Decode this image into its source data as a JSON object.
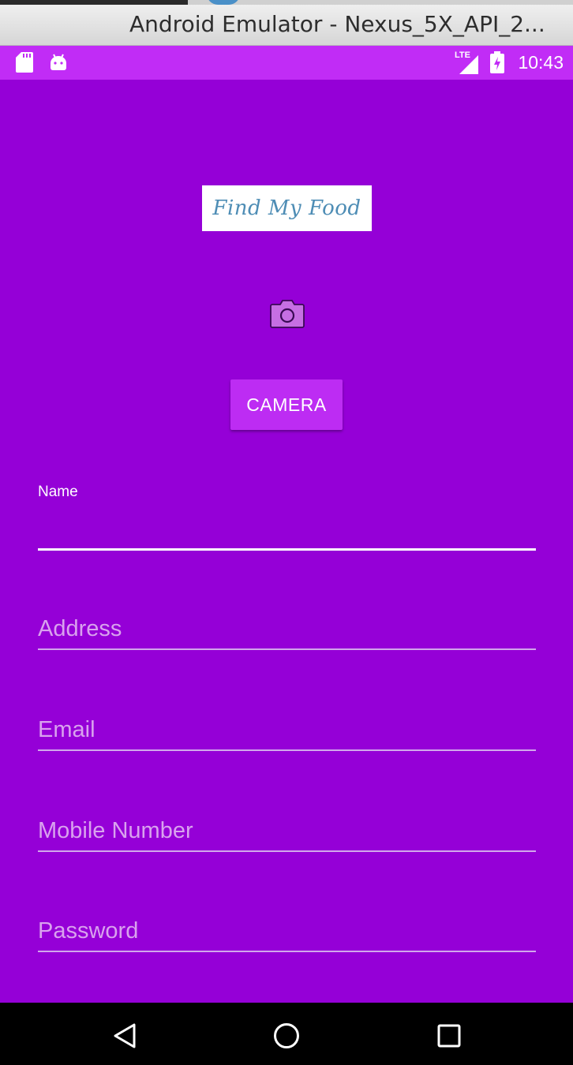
{
  "window": {
    "title": "Android Emulator - Nexus_5X_API_2..."
  },
  "status_bar": {
    "time": "10:43",
    "network_label": "LTE",
    "icons": [
      "sd-card-icon",
      "android-icon",
      "lte-signal-icon",
      "battery-icon"
    ]
  },
  "app": {
    "logo_text": "Find My Food",
    "camera_icon": "camera-icon",
    "camera_button_label": "CAMERA",
    "fields": [
      {
        "key": "name",
        "floating_label": "Name",
        "value": "",
        "placeholder": "",
        "focused": true
      },
      {
        "key": "address",
        "placeholder": "Address",
        "value": ""
      },
      {
        "key": "email",
        "placeholder": "Email",
        "value": ""
      },
      {
        "key": "mobile",
        "placeholder": "Mobile Number",
        "value": ""
      },
      {
        "key": "password",
        "placeholder": "Password",
        "value": ""
      }
    ]
  },
  "nav_bar": {
    "buttons": [
      "back-icon",
      "home-icon",
      "recents-icon"
    ]
  },
  "colors": {
    "app_background": "#9500d7",
    "status_bar": "#c12cf6",
    "button": "#bd2cf3",
    "placeholder": "#d9a2ee",
    "logo_text": "#4e8db5"
  }
}
